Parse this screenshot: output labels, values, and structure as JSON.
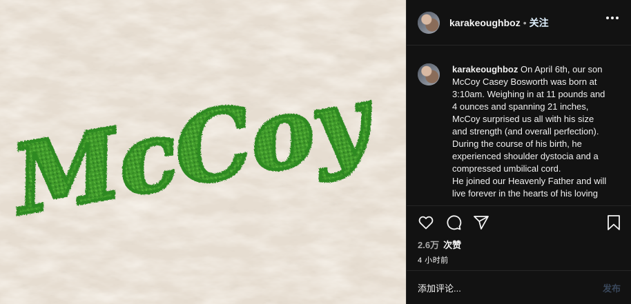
{
  "photo": {
    "word": "McCoy"
  },
  "header": {
    "username": "karakeoughboz",
    "separator": "•",
    "follow_label": "关注"
  },
  "caption": {
    "username": "karakeoughboz",
    "lines": [
      "On April 6th, our son",
      "McCoy Casey Bosworth was born at",
      "3:10am. Weighing in at 11 pounds and",
      "4 ounces and spanning 21 inches,",
      "McCoy surprised us all with his size",
      "and strength (and overall perfection).",
      "During the course of his birth, he",
      "experienced shoulder dystocia and a",
      "compressed umbilical cord.",
      "He joined our Heavenly Father and will",
      "live forever in the hearts of his loving"
    ]
  },
  "stats": {
    "likes_count": "2.6万",
    "likes_label": "次赞",
    "time_ago": "4 小时前"
  },
  "composer": {
    "placeholder": "添加评论...",
    "post_label": "发布"
  },
  "icons": [
    "heart-icon",
    "comment-icon",
    "share-icon",
    "bookmark-icon",
    "more-icon"
  ],
  "colors": {
    "panel_bg": "#121212",
    "moss_green": "#3f9a2c",
    "follow_blue": "#e0f1ff",
    "post_disabled": "#39475a"
  }
}
